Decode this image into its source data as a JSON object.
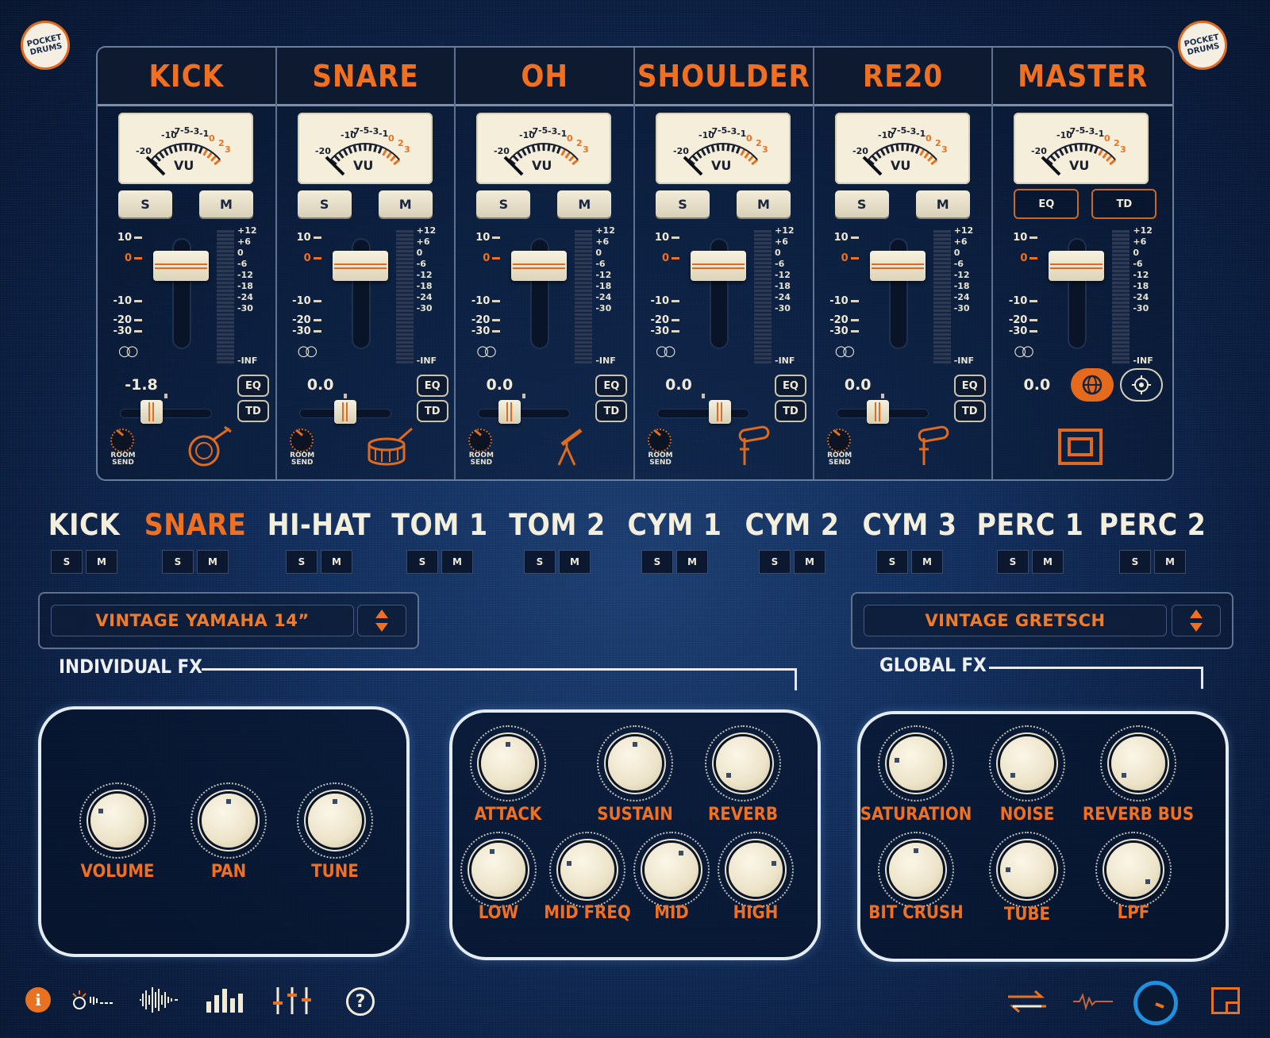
{
  "app": {
    "logo_text": "POCKET DRUMS"
  },
  "mixer": {
    "channels": [
      {
        "name": "KICK",
        "value": "-1.8",
        "solo": "S",
        "mute": "M",
        "eq": "EQ",
        "td": "TD",
        "room_send": "ROOM SEND",
        "instrument_icon": "kick-drum-icon",
        "pan": -0.3
      },
      {
        "name": "SNARE",
        "value": "0.0",
        "solo": "S",
        "mute": "M",
        "eq": "EQ",
        "td": "TD",
        "room_send": "ROOM SEND",
        "instrument_icon": "snare-drum-icon",
        "pan": 0.0
      },
      {
        "name": "OH",
        "value": "0.0",
        "solo": "S",
        "mute": "M",
        "eq": "EQ",
        "td": "TD",
        "room_send": "ROOM SEND",
        "instrument_icon": "overhead-mic-icon",
        "pan": -0.3
      },
      {
        "name": "SHOULDER",
        "value": "0.0",
        "solo": "S",
        "mute": "M",
        "eq": "EQ",
        "td": "TD",
        "room_send": "ROOM SEND",
        "instrument_icon": "shoulder-mic-icon",
        "pan": 0.35
      },
      {
        "name": "RE20",
        "value": "0.0",
        "solo": "S",
        "mute": "M",
        "eq": "EQ",
        "td": "TD",
        "room_send": "ROOM SEND",
        "instrument_icon": "re20-mic-icon",
        "pan": -0.1
      }
    ],
    "master": {
      "name": "MASTER",
      "value": "0.0",
      "eq": "EQ",
      "td": "TD"
    },
    "fader_scale": [
      "10",
      "0",
      "-10",
      "-20",
      "-30"
    ],
    "meter_scale": [
      "+12",
      "+6",
      "0",
      "-6",
      "-12",
      "-18",
      "-24",
      "-30"
    ],
    "meter_inf": "-INF",
    "vu_label": "VU",
    "vu_ticks": [
      "-20",
      "-10",
      "-7",
      "-5",
      "-3",
      "-1",
      "0",
      "2",
      "3"
    ]
  },
  "instruments": [
    {
      "name": "KICK",
      "active": false
    },
    {
      "name": "SNARE",
      "active": true
    },
    {
      "name": "HI-HAT",
      "active": false
    },
    {
      "name": "TOM 1",
      "active": false
    },
    {
      "name": "TOM 2",
      "active": false
    },
    {
      "name": "CYM 1",
      "active": false
    },
    {
      "name": "CYM 2",
      "active": false
    },
    {
      "name": "CYM 3",
      "active": false
    },
    {
      "name": "PERC 1",
      "active": false
    },
    {
      "name": "PERC 2",
      "active": false
    }
  ],
  "sm": {
    "solo": "S",
    "mute": "M"
  },
  "presets": {
    "individual": "VINTAGE YAMAHA 14”",
    "global": "VINTAGE GRETSCH"
  },
  "sections": {
    "individual_fx": "INDIVIDUAL FX",
    "global_fx": "GLOBAL FX"
  },
  "knobs": {
    "panel1": [
      "VOLUME",
      "PAN",
      "TUNE"
    ],
    "panel2_top": [
      "ATTACK",
      "SUSTAIN",
      "REVERB"
    ],
    "panel2_bottom": [
      "LOW",
      "MID FREQ",
      "MID",
      "HIGH"
    ],
    "panel3_top": [
      "SATURATION",
      "NOISE",
      "REVERB BUS"
    ],
    "panel3_bottom": [
      "BIT CRUSH",
      "TUBE",
      "LPF"
    ]
  },
  "bottom": {
    "info": "i",
    "help": "?"
  },
  "colors": {
    "accent": "#f07020",
    "background": "#123060",
    "panel_border": "#e3ecf2",
    "cream": "#f4eedb"
  }
}
